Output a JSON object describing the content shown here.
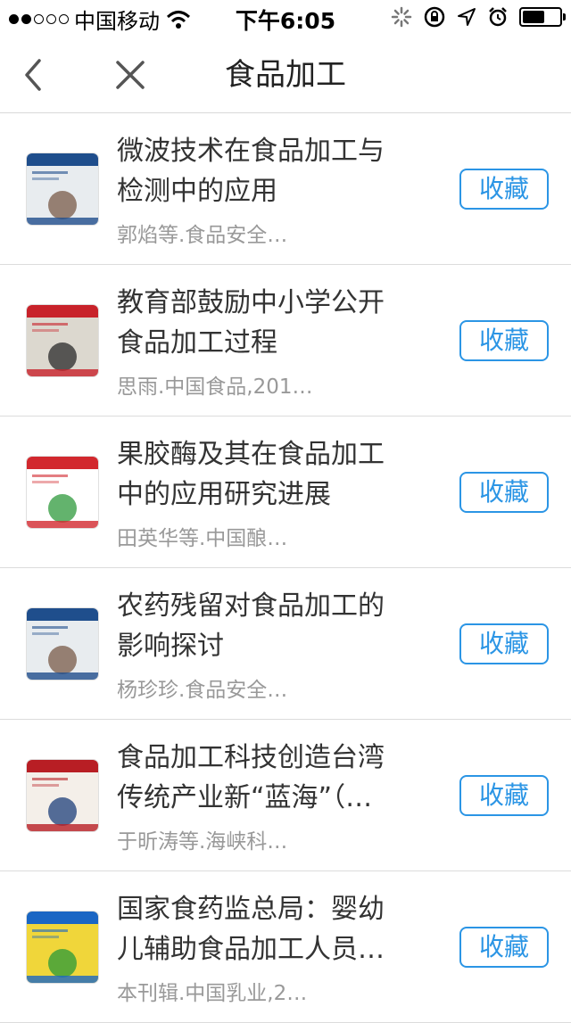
{
  "status_bar": {
    "carrier": "中国移动",
    "time": "下午6:05",
    "signal_bars_on": 2,
    "signal_bars_total": 5,
    "battery_level": 0.6
  },
  "nav": {
    "title": "食品加工"
  },
  "button_color": "#2b95e5",
  "items": [
    {
      "title": "微波技术在食品加工与\n检测中的应用",
      "meta": "郭焰等.食品安全…",
      "button": "收藏",
      "cover_colors": [
        "#1f4e8c",
        "#e8ecef",
        "#7a5b48"
      ]
    },
    {
      "title": "教育部鼓励中小学公开\n食品加工过程",
      "meta": "思雨.中国食品,201…",
      "button": "收藏",
      "cover_colors": [
        "#c8222a",
        "#dcd8cf",
        "#2a2a2a"
      ]
    },
    {
      "title": "果胶酶及其在食品加工\n中的应用研究进展",
      "meta": "田英华等.中国酿…",
      "button": "收藏",
      "cover_colors": [
        "#d2282e",
        "#ffffff",
        "#2f9a3c"
      ]
    },
    {
      "title": "农药残留对食品加工的\n影响探讨",
      "meta": "杨珍珍.食品安全…",
      "button": "收藏",
      "cover_colors": [
        "#1f4e8c",
        "#e8ecef",
        "#7a5b48"
      ]
    },
    {
      "title": "食品加工科技创造台湾\n传统产业新“蓝海”（…",
      "meta": "于昕涛等.海峡科…",
      "button": "收藏",
      "cover_colors": [
        "#b81e24",
        "#f4efe9",
        "#1e3f7a"
      ]
    },
    {
      "title": "国家食药监总局：婴幼\n儿辅助食品加工人员…",
      "meta": "本刊辑.中国乳业,2…",
      "button": "收藏",
      "cover_colors": [
        "#1a66c4",
        "#f0d63a",
        "#2a9a3a"
      ]
    }
  ]
}
